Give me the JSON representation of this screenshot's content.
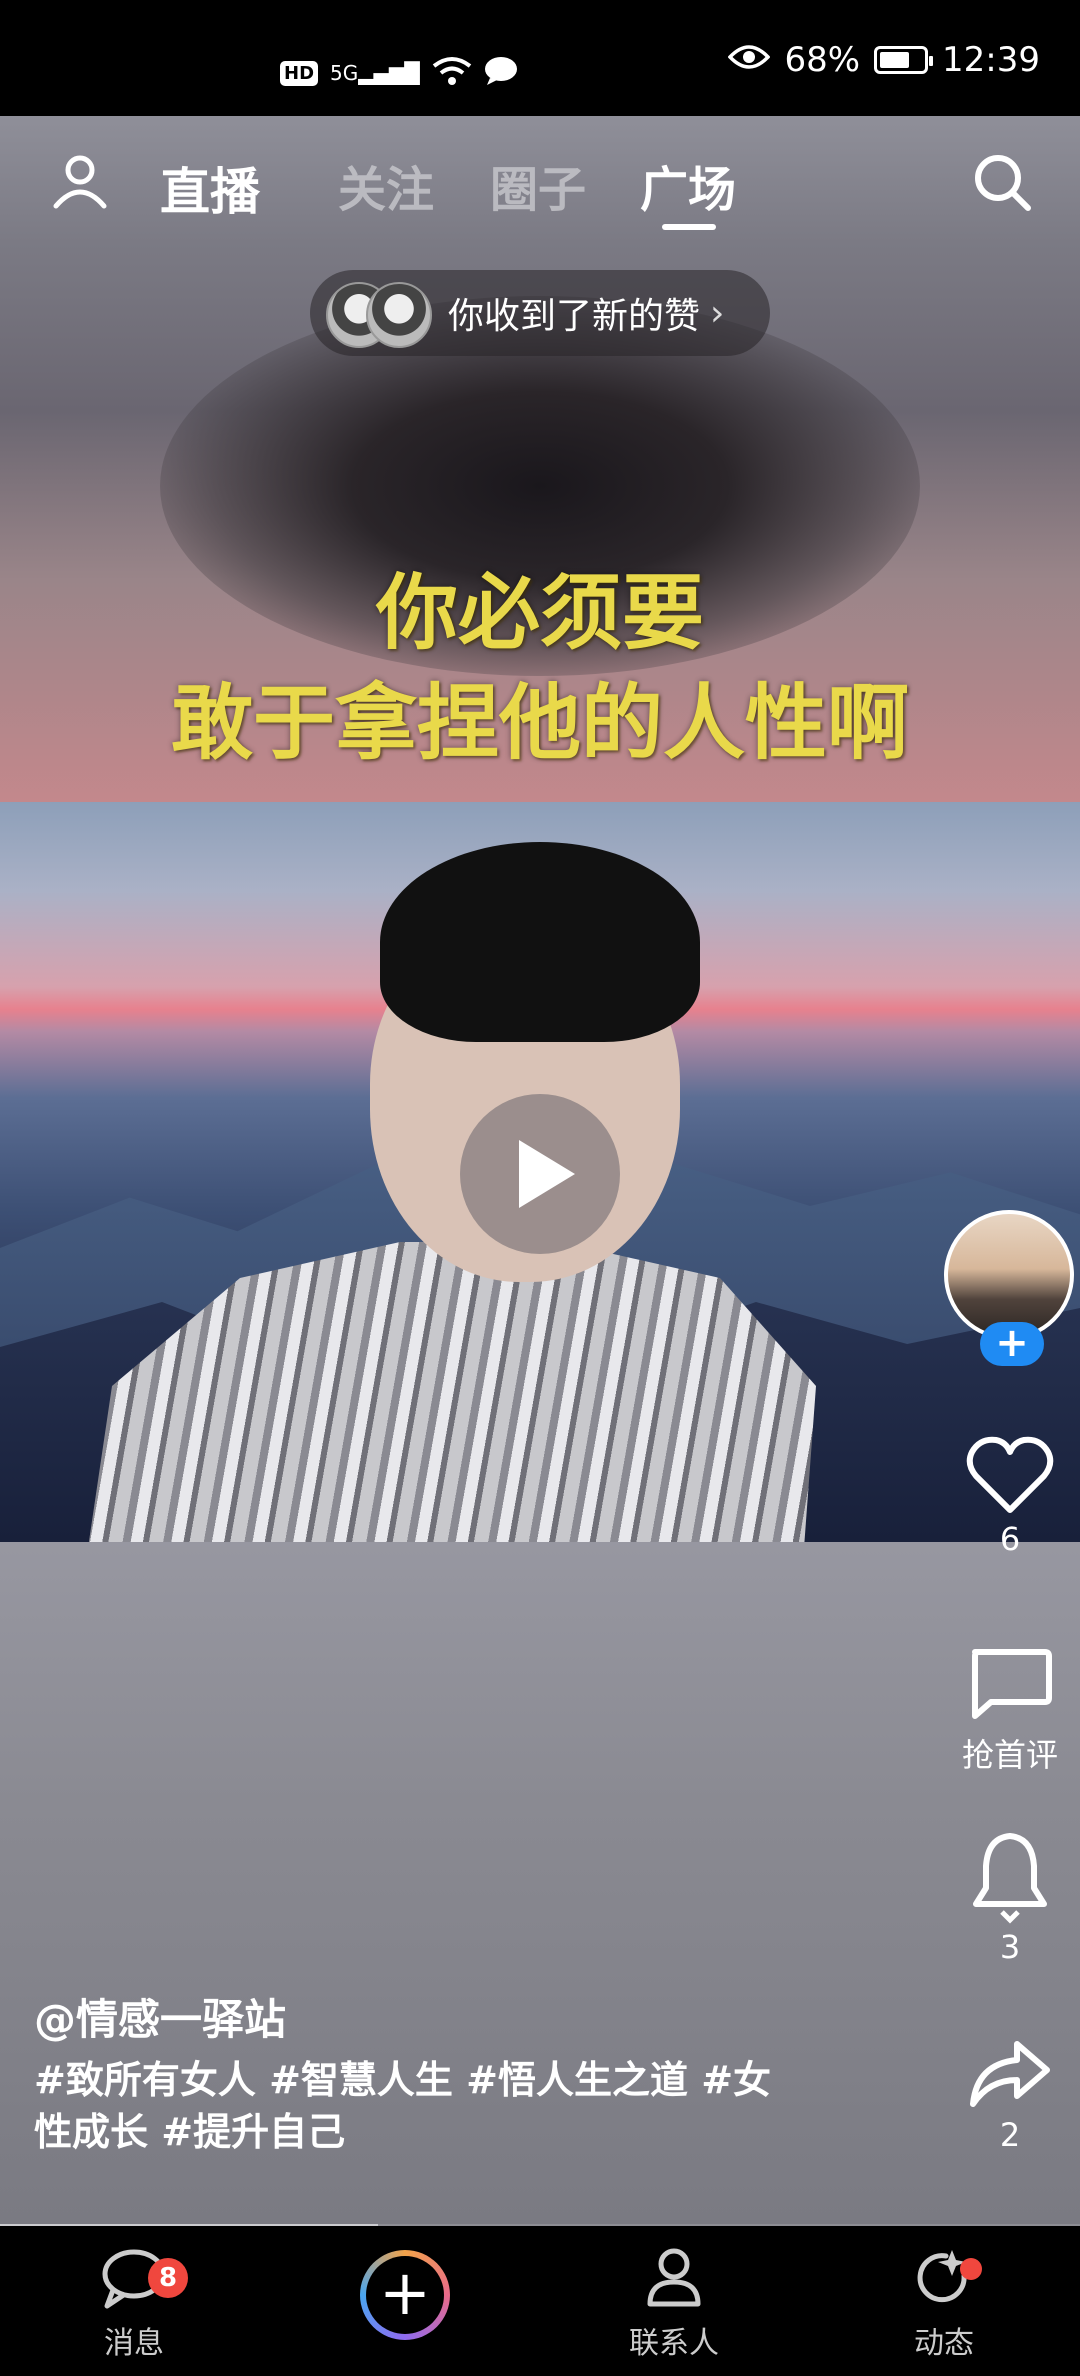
{
  "status_bar": {
    "hd": "HD",
    "network": "5G",
    "battery_percent": "68%",
    "battery_level": 0.68,
    "time": "12:39"
  },
  "top_nav": {
    "logo": "直播",
    "tabs": [
      {
        "label": "关注",
        "active": false
      },
      {
        "label": "圈子",
        "active": false
      },
      {
        "label": "广场",
        "active": true
      }
    ]
  },
  "notification": {
    "text": "你收到了新的赞",
    "arrow": "›"
  },
  "video": {
    "subtitle_line1": "你必须要",
    "subtitle_line2": "敢于拿捏他的人性啊",
    "progress": 0.35
  },
  "rail": {
    "follow_label": "+",
    "like_count": "6",
    "comment_label": "抢首评",
    "bell_count": "3",
    "share_count": "2"
  },
  "post": {
    "author": "@情感一驿站",
    "tags_line1": "#致所有女人 #智慧人生 #悟人生之道 #女",
    "tags_line2": "性成长 #提升自己"
  },
  "bottom_nav": {
    "messages_label": "消息",
    "messages_badge": "8",
    "add_label": "+",
    "contacts_label": "联系人",
    "dynamics_label": "动态"
  },
  "colors": {
    "subtitle": "#e9d94a",
    "follow_button": "#1f8bf3",
    "badge": "#f0473e"
  }
}
